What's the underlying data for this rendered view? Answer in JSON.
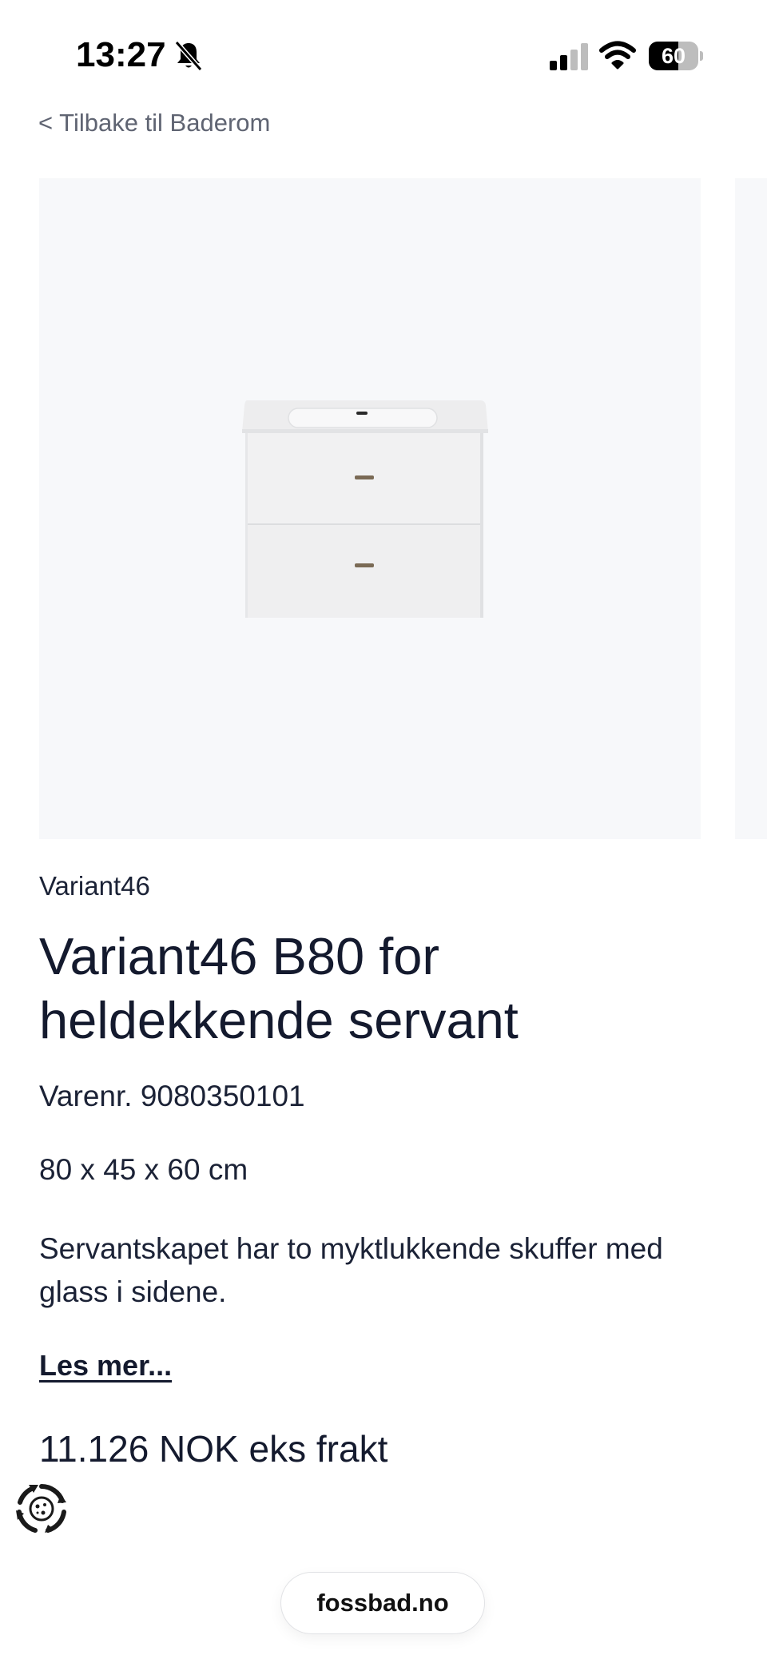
{
  "status_bar": {
    "time": "13:27",
    "battery_percent": "60",
    "battery_level": 0.6,
    "icons": [
      "bell-slash-icon",
      "cellular-signal-icon",
      "wifi-icon",
      "battery-icon"
    ]
  },
  "nav": {
    "back_label": "< Tilbake til Baderom"
  },
  "product": {
    "brand": "Variant46",
    "title": "Variant46 B80 for heldekkende servant",
    "sku": "Varenr. 9080350101",
    "dimensions": "80 x 45 x 60 cm",
    "description": "Servantskapet har to myktlukkende skuffer med glass i sidene.",
    "read_more": "Les mer...",
    "price": "11.126 NOK eks frakt"
  },
  "browser": {
    "url": "fossbad.no"
  },
  "colors": {
    "text_primary": "#141a2e",
    "text_secondary": "#5f6472",
    "image_background": "#f7f8fa"
  }
}
